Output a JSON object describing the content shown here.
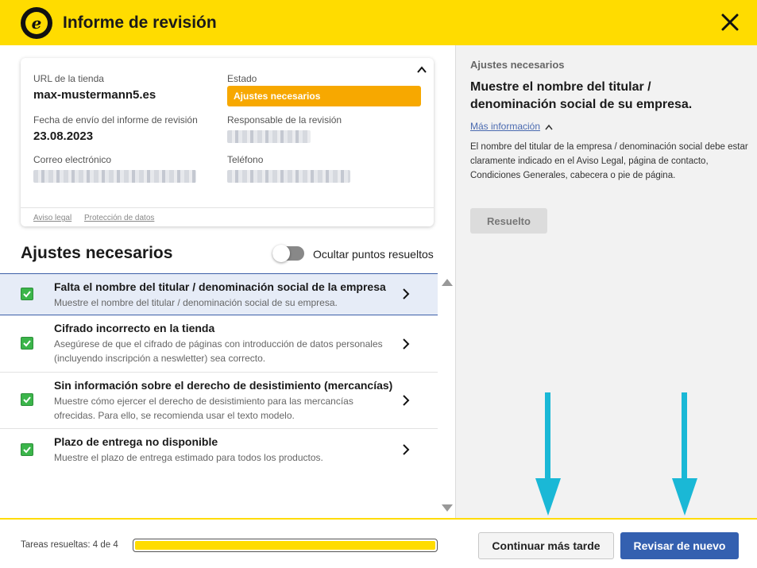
{
  "header": {
    "title": "Informe de revisión",
    "logo_letter": "e",
    "close_icon": "close-icon"
  },
  "info_card": {
    "store_url_label": "URL de la tienda",
    "store_url": "max-mustermann5.es",
    "status_label": "Estado",
    "status_value": "Ajustes necesarios",
    "sent_date_label": "Fecha de envío del informe de revisión",
    "sent_date": "23.08.2023",
    "reviewer_label": "Responsable de la revisión",
    "email_label": "Correo electrónico",
    "phone_label": "Teléfono",
    "footer_links": [
      "Aviso legal",
      "Protección de datos"
    ]
  },
  "list_section": {
    "title": "Ajustes necesarios",
    "toggle_label": "Ocultar puntos resueltos",
    "items": [
      {
        "title": "Falta el nombre del titular / denominación social de la empresa",
        "subtitle": "Muestre el nombre del titular / denominación social de su empresa."
      },
      {
        "title": "Cifrado incorrecto en la tienda",
        "subtitle": "Asegúrese de que el cifrado de páginas con introducción de datos personales (incluyendo inscripción a neswletter) sea correcto."
      },
      {
        "title": "Sin información sobre el derecho de desistimiento (mercancías)",
        "subtitle": "Muestre cómo ejercer el derecho de desistimiento para las mercancías ofrecidas. Para ello, se recomienda usar el texto modelo."
      },
      {
        "title": "Plazo de entrega no disponible",
        "subtitle": "Muestre el plazo de entrega estimado para todos los productos."
      }
    ]
  },
  "detail_panel": {
    "label": "Ajustes necesarios",
    "title": "Muestre el nombre del titular / denominación social de su empresa.",
    "more_info": "Más información",
    "body": "El nombre del titular de la empresa / denominación social debe estar claramente indicado en el Aviso Legal, página de contacto, Condiciones Generales, cabecera o pie de página.",
    "resolved_button": "Resuelto"
  },
  "footer": {
    "tasks_label": "Tareas resueltas: 4 de 4",
    "progress": 1.0,
    "later_button": "Continuar más tarde",
    "review_button": "Revisar de nuevo"
  },
  "colors": {
    "brand_yellow": "#ffdc00",
    "status_orange": "#f7a800",
    "primary_blue": "#3460b0",
    "check_green": "#3bb54a",
    "annotation_cyan": "#1ab8d6"
  }
}
